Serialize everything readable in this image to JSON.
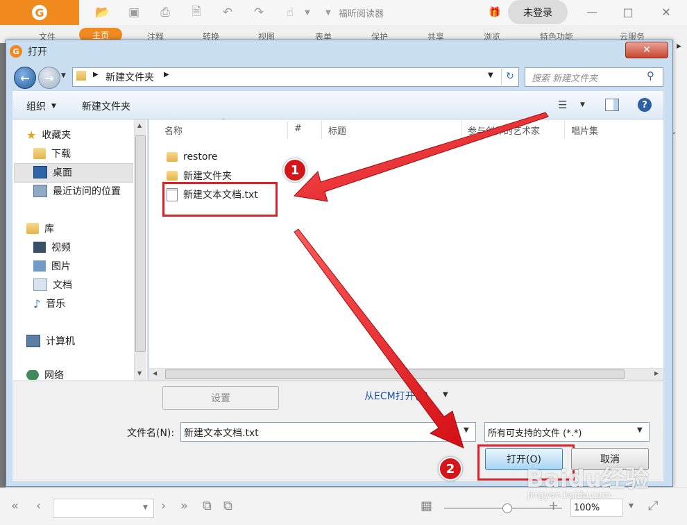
{
  "app": {
    "title": "福昕阅读器",
    "login_label": "未登录",
    "ribbon_tabs": [
      "文件",
      "主页",
      "注释",
      "转换",
      "视图",
      "表单",
      "保护",
      "共享",
      "浏览",
      "特色功能",
      "云服务"
    ],
    "accent": "#f08a1e"
  },
  "dialog": {
    "title": "打开",
    "breadcrumb": "新建文件夹",
    "search_placeholder": "搜索 新建文件夹",
    "toolbar": {
      "organize": "组织",
      "new_folder": "新建文件夹"
    },
    "nav": {
      "favorites": {
        "label": "收藏夹",
        "items": [
          "下载",
          "桌面",
          "最近访问的位置"
        ]
      },
      "libraries": {
        "label": "库",
        "items": [
          "视频",
          "图片",
          "文档",
          "音乐"
        ]
      },
      "computer": "计算机",
      "network": "网络"
    },
    "columns": [
      "名称",
      "#",
      "标题",
      "参与创作的艺术家",
      "唱片集"
    ],
    "files": [
      {
        "name": "restore",
        "type": "folder"
      },
      {
        "name": "新建文件夹",
        "type": "folder"
      },
      {
        "name": "新建文本文档.txt",
        "type": "text"
      }
    ],
    "settings_label": "设置",
    "ecm_label": "从ECM打开(E)",
    "filename_label": "文件名(N):",
    "filename_value": "新建文本文档.txt",
    "filter_value": "所有可支持的文件 (*.*)",
    "open_label": "打开(O)",
    "cancel_label": "取消"
  },
  "annotations": {
    "step1": "1",
    "step2": "2",
    "color": "#e0202a"
  },
  "statusbar": {
    "zoom": "100%"
  },
  "watermark": {
    "brand": "Baidu经验",
    "url": "jingyan.baidu.com"
  }
}
